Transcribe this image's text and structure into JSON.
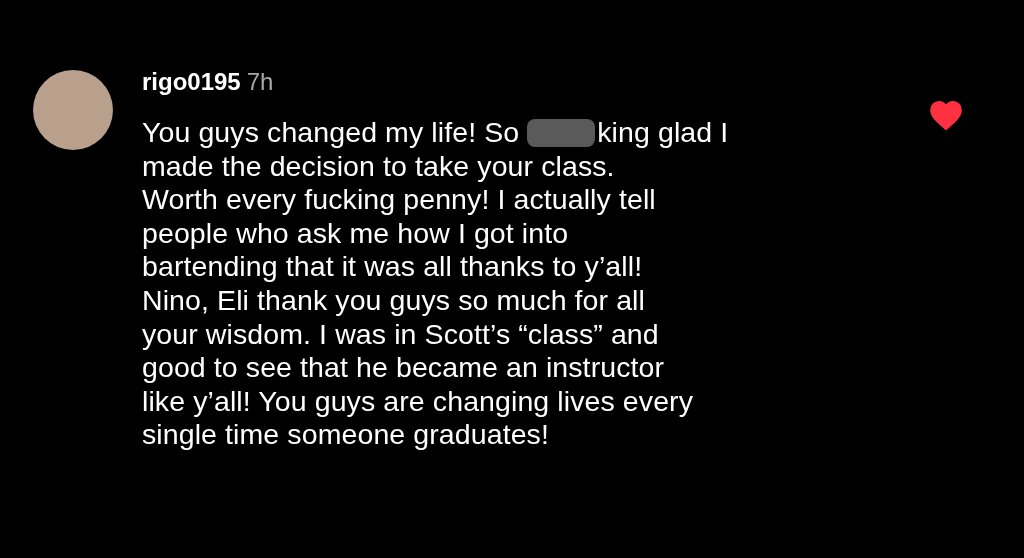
{
  "comment": {
    "username": "rigo0195",
    "time": "7h",
    "liked": true,
    "first_line": [
      {
        "kind": "text",
        "text": "You guys changed my life! So"
      },
      {
        "kind": "blur"
      },
      {
        "kind": "text",
        "text": "king glad I"
      }
    ],
    "rest": "made the decision to take your class.\nWorth every fucking penny! I actually tell\npeople who ask me how I got into\nbartending that it was all thanks to y’all!\nNino, Eli thank you guys so much for all\nyour wisdom. I was in Scott’s “class” and\ngood to see that he became an instructor\nlike y’all! You guys are changing lives every\nsingle time someone graduates!"
  }
}
